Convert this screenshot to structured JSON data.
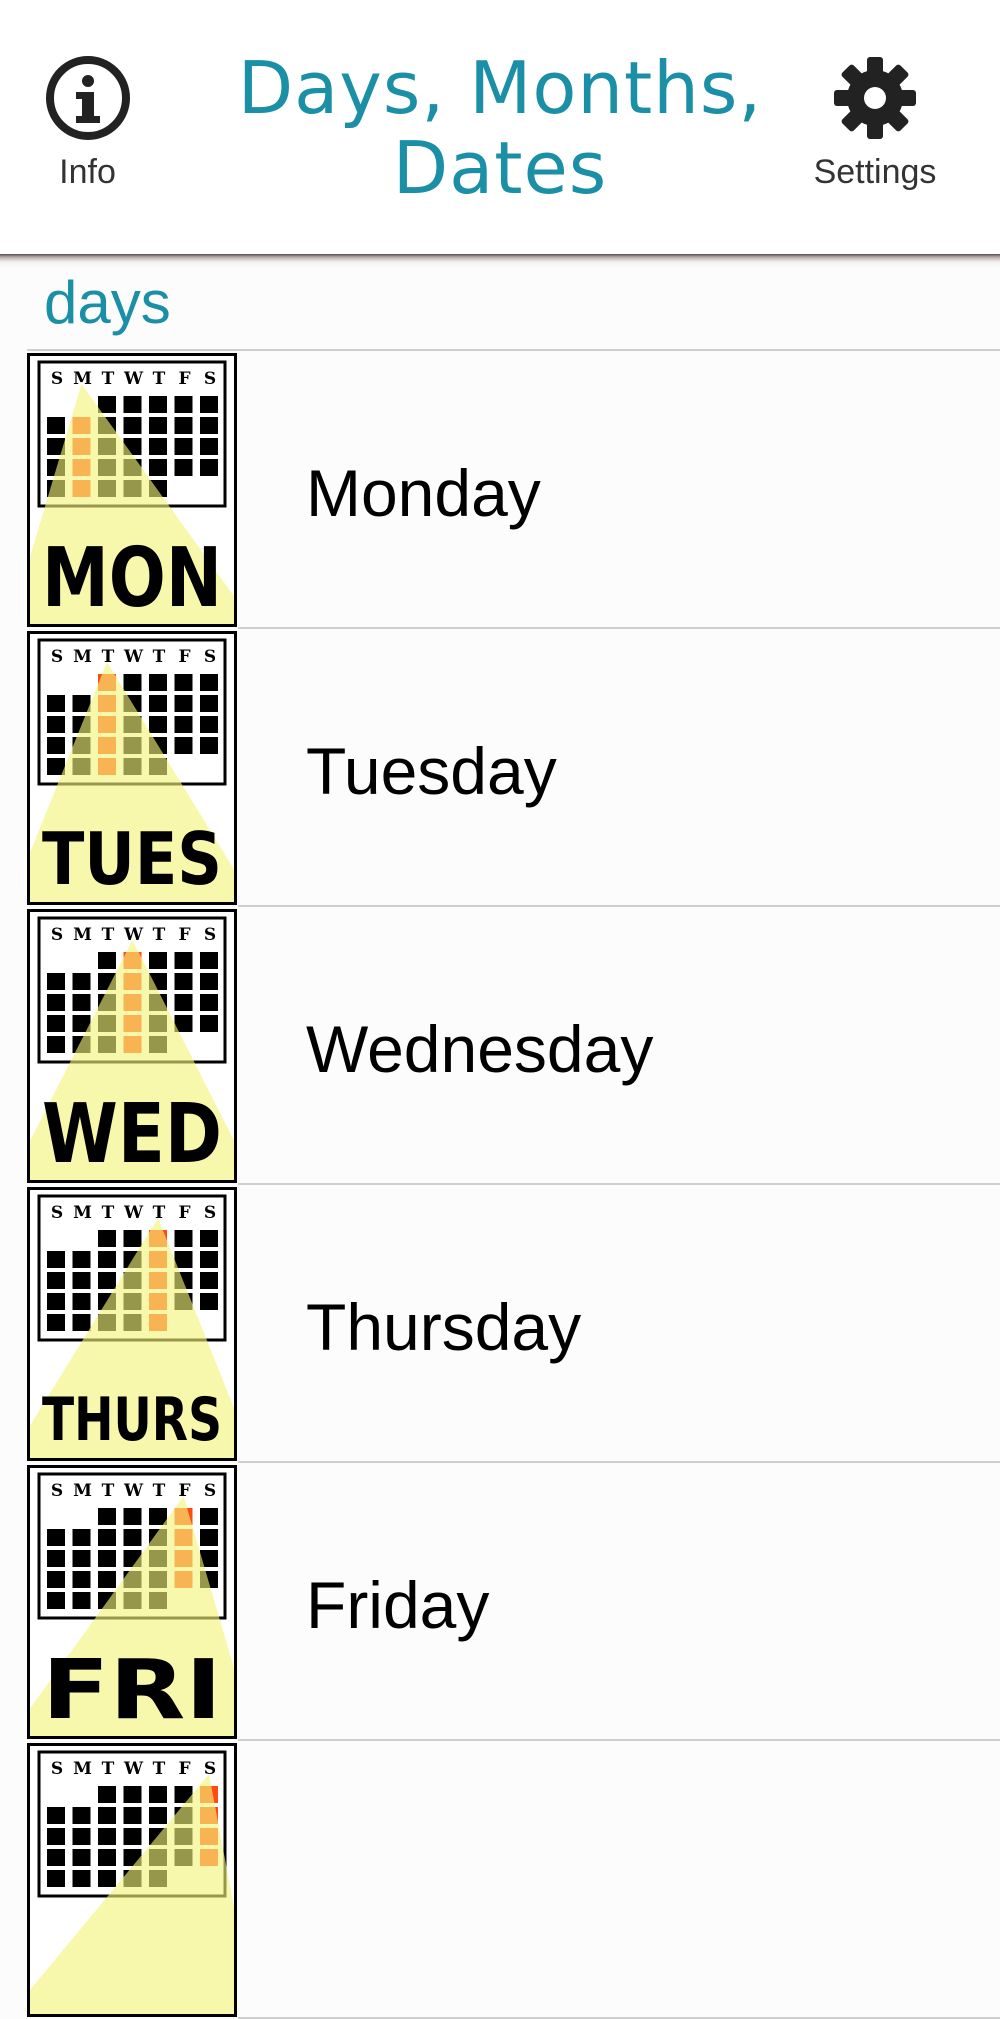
{
  "header": {
    "title_line1": "Days, Months,",
    "title_line2": "Dates",
    "info_label": "Info",
    "settings_label": "Settings"
  },
  "section": {
    "title": "days"
  },
  "calendar_letters": [
    "S",
    "M",
    "T",
    "W",
    "T",
    "F",
    "S"
  ],
  "days": [
    {
      "label": "Monday",
      "abbr": "MON",
      "col": 1,
      "icon": "monday-calendar-icon"
    },
    {
      "label": "Tuesday",
      "abbr": "TUES",
      "col": 2,
      "icon": "tuesday-calendar-icon"
    },
    {
      "label": "Wednesday",
      "abbr": "WED",
      "col": 3,
      "icon": "wednesday-calendar-icon"
    },
    {
      "label": "Thursday",
      "abbr": "THURS",
      "col": 4,
      "icon": "thursday-calendar-icon"
    },
    {
      "label": "Friday",
      "abbr": "FRI",
      "col": 5,
      "icon": "friday-calendar-icon"
    },
    {
      "label": "",
      "abbr": "",
      "col": 6,
      "icon": "saturday-calendar-icon"
    }
  ],
  "colors": {
    "accent": "#1a8fa6",
    "highlight": "#ff4a14",
    "spotlight": "#f4f47a",
    "text": "#000000"
  }
}
